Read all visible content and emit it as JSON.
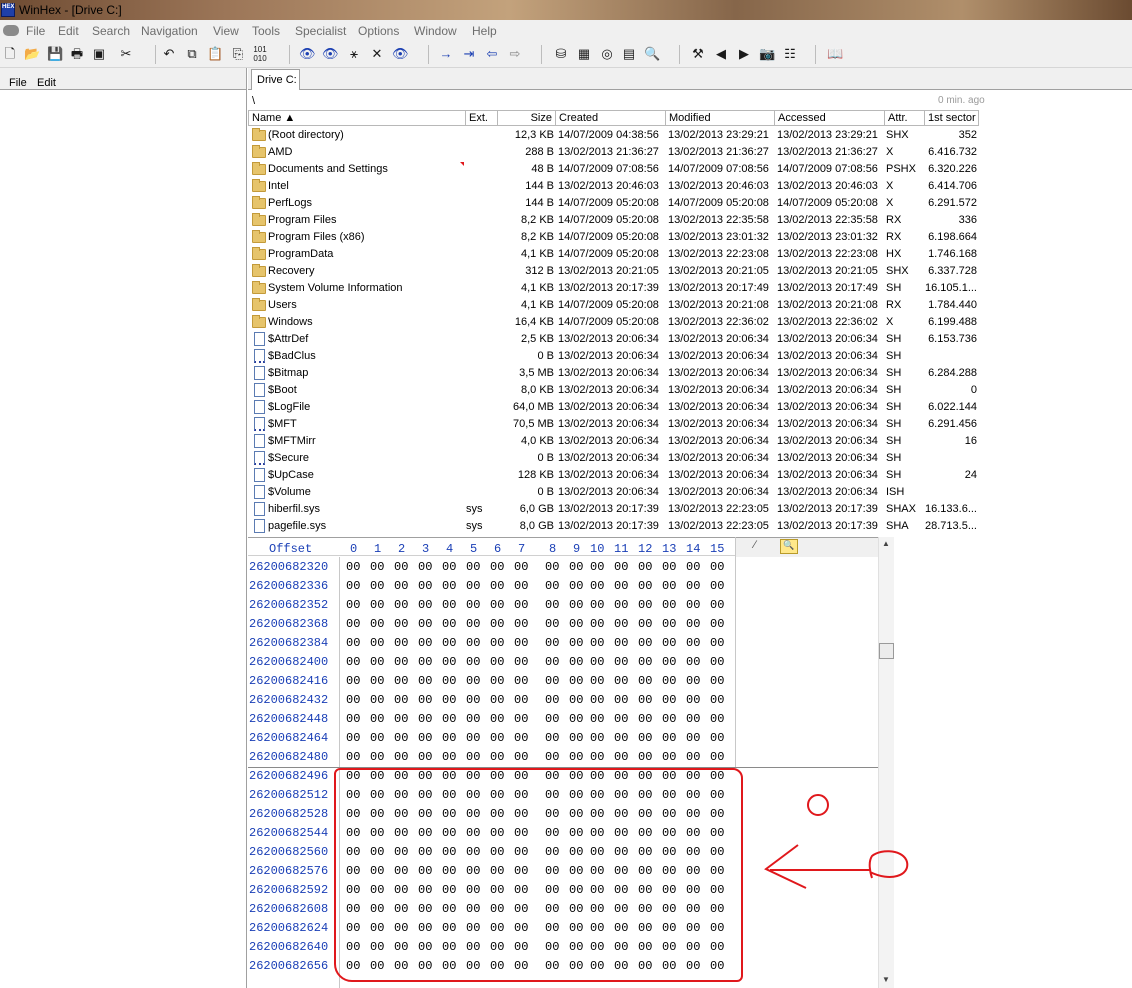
{
  "window": {
    "title": "WinHex - [Drive C:]",
    "app_icon_text": "HEX"
  },
  "menu": [
    "File",
    "Edit",
    "Search",
    "Navigation",
    "View",
    "Tools",
    "Specialist",
    "Options",
    "Window",
    "Help"
  ],
  "toolbar": {
    "icons": [
      "new-file-icon",
      "open-icon",
      "save-icon",
      "print-icon",
      "properties-icon",
      "cut-icon",
      "undo-icon",
      "copy-icon",
      "paste-icon",
      "paste-special-icon",
      "copy-hex-icon",
      "find-icon",
      "find-hex-icon",
      "replace-icon",
      "replace-hex-icon",
      "find-next-icon",
      "goto-offset-icon",
      "goto-sector-icon",
      "back-icon",
      "forward-icon",
      "disk-icon",
      "ram-icon",
      "drive-icon",
      "calculator-icon",
      "search-icon",
      "tools-icon",
      "prev-icon",
      "next-icon",
      "snapshot-icon",
      "list-icon",
      "help-icon"
    ]
  },
  "left_menu": {
    "file": "File",
    "edit": "Edit"
  },
  "tab": {
    "label": "Drive C:"
  },
  "path": {
    "current": "\\",
    "ago": "0 min. ago"
  },
  "columns": [
    {
      "key": "name",
      "label": "Name ▲"
    },
    {
      "key": "ext",
      "label": "Ext."
    },
    {
      "key": "size",
      "label": "Size"
    },
    {
      "key": "created",
      "label": "Created"
    },
    {
      "key": "modified",
      "label": "Modified"
    },
    {
      "key": "accessed",
      "label": "Accessed"
    },
    {
      "key": "attr",
      "label": "Attr."
    },
    {
      "key": "sector",
      "label": "1st sector"
    }
  ],
  "files": [
    {
      "name": "(Root directory)",
      "ext": "",
      "size": "12,3 KB",
      "created": "14/07/2009  04:38:56",
      "modified": "13/02/2013  23:29:21",
      "accessed": "13/02/2013  23:29:21",
      "attr": "SHX",
      "sector": "352",
      "icon": "folder"
    },
    {
      "name": "AMD",
      "ext": "",
      "size": "288 B",
      "created": "13/02/2013  21:36:27",
      "modified": "13/02/2013  21:36:27",
      "accessed": "13/02/2013  21:36:27",
      "attr": "X",
      "sector": "6.416.732",
      "icon": "folder"
    },
    {
      "name": "Documents and Settings",
      "ext": "",
      "size": "48 B",
      "created": "14/07/2009  07:08:56",
      "modified": "14/07/2009  07:08:56",
      "accessed": "14/07/2009  07:08:56",
      "attr": "PSHX",
      "sector": "6.320.226",
      "icon": "folder"
    },
    {
      "name": "Intel",
      "ext": "",
      "size": "144 B",
      "created": "13/02/2013  20:46:03",
      "modified": "13/02/2013  20:46:03",
      "accessed": "13/02/2013  20:46:03",
      "attr": "X",
      "sector": "6.414.706",
      "icon": "folder"
    },
    {
      "name": "PerfLogs",
      "ext": "",
      "size": "144 B",
      "created": "14/07/2009  05:20:08",
      "modified": "14/07/2009  05:20:08",
      "accessed": "14/07/2009  05:20:08",
      "attr": "X",
      "sector": "6.291.572",
      "icon": "folder"
    },
    {
      "name": "Program Files",
      "ext": "",
      "size": "8,2 KB",
      "created": "14/07/2009  05:20:08",
      "modified": "13/02/2013  22:35:58",
      "accessed": "13/02/2013  22:35:58",
      "attr": "RX",
      "sector": "336",
      "icon": "folder"
    },
    {
      "name": "Program Files (x86)",
      "ext": "",
      "size": "8,2 KB",
      "created": "14/07/2009  05:20:08",
      "modified": "13/02/2013  23:01:32",
      "accessed": "13/02/2013  23:01:32",
      "attr": "RX",
      "sector": "6.198.664",
      "icon": "folder"
    },
    {
      "name": "ProgramData",
      "ext": "",
      "size": "4,1 KB",
      "created": "14/07/2009  05:20:08",
      "modified": "13/02/2013  22:23:08",
      "accessed": "13/02/2013  22:23:08",
      "attr": "HX",
      "sector": "1.746.168",
      "icon": "folder"
    },
    {
      "name": "Recovery",
      "ext": "",
      "size": "312 B",
      "created": "13/02/2013  20:21:05",
      "modified": "13/02/2013  20:21:05",
      "accessed": "13/02/2013  20:21:05",
      "attr": "SHX",
      "sector": "6.337.728",
      "icon": "folder"
    },
    {
      "name": "System Volume Information",
      "ext": "",
      "size": "4,1 KB",
      "created": "13/02/2013  20:17:39",
      "modified": "13/02/2013  20:17:49",
      "accessed": "13/02/2013  20:17:49",
      "attr": "SH",
      "sector": "16.105.1...",
      "icon": "folder"
    },
    {
      "name": "Users",
      "ext": "",
      "size": "4,1 KB",
      "created": "14/07/2009  05:20:08",
      "modified": "13/02/2013  20:21:08",
      "accessed": "13/02/2013  20:21:08",
      "attr": "RX",
      "sector": "1.784.440",
      "icon": "folder"
    },
    {
      "name": "Windows",
      "ext": "",
      "size": "16,4 KB",
      "created": "14/07/2009  05:20:08",
      "modified": "13/02/2013  22:36:02",
      "accessed": "13/02/2013  22:36:02",
      "attr": "X",
      "sector": "6.199.488",
      "icon": "folder"
    },
    {
      "name": "$AttrDef",
      "ext": "",
      "size": "2,5 KB",
      "created": "13/02/2013  20:06:34",
      "modified": "13/02/2013  20:06:34",
      "accessed": "13/02/2013  20:06:34",
      "attr": "SH",
      "sector": "6.153.736",
      "icon": "file"
    },
    {
      "name": "$BadClus",
      "ext": "",
      "size": "0 B",
      "created": "13/02/2013  20:06:34",
      "modified": "13/02/2013  20:06:34",
      "accessed": "13/02/2013  20:06:34",
      "attr": "SH",
      "sector": "",
      "icon": "file-dots"
    },
    {
      "name": "$Bitmap",
      "ext": "",
      "size": "3,5 MB",
      "created": "13/02/2013  20:06:34",
      "modified": "13/02/2013  20:06:34",
      "accessed": "13/02/2013  20:06:34",
      "attr": "SH",
      "sector": "6.284.288",
      "icon": "file"
    },
    {
      "name": "$Boot",
      "ext": "",
      "size": "8,0 KB",
      "created": "13/02/2013  20:06:34",
      "modified": "13/02/2013  20:06:34",
      "accessed": "13/02/2013  20:06:34",
      "attr": "SH",
      "sector": "0",
      "icon": "file"
    },
    {
      "name": "$LogFile",
      "ext": "",
      "size": "64,0 MB",
      "created": "13/02/2013  20:06:34",
      "modified": "13/02/2013  20:06:34",
      "accessed": "13/02/2013  20:06:34",
      "attr": "SH",
      "sector": "6.022.144",
      "icon": "file"
    },
    {
      "name": "$MFT",
      "ext": "",
      "size": "70,5 MB",
      "created": "13/02/2013  20:06:34",
      "modified": "13/02/2013  20:06:34",
      "accessed": "13/02/2013  20:06:34",
      "attr": "SH",
      "sector": "6.291.456",
      "icon": "file-dots"
    },
    {
      "name": "$MFTMirr",
      "ext": "",
      "size": "4,0 KB",
      "created": "13/02/2013  20:06:34",
      "modified": "13/02/2013  20:06:34",
      "accessed": "13/02/2013  20:06:34",
      "attr": "SH",
      "sector": "16",
      "icon": "file"
    },
    {
      "name": "$Secure",
      "ext": "",
      "size": "0 B",
      "created": "13/02/2013  20:06:34",
      "modified": "13/02/2013  20:06:34",
      "accessed": "13/02/2013  20:06:34",
      "attr": "SH",
      "sector": "",
      "icon": "file-dots"
    },
    {
      "name": "$UpCase",
      "ext": "",
      "size": "128 KB",
      "created": "13/02/2013  20:06:34",
      "modified": "13/02/2013  20:06:34",
      "accessed": "13/02/2013  20:06:34",
      "attr": "SH",
      "sector": "24",
      "icon": "file"
    },
    {
      "name": "$Volume",
      "ext": "",
      "size": "0 B",
      "created": "13/02/2013  20:06:34",
      "modified": "13/02/2013  20:06:34",
      "accessed": "13/02/2013  20:06:34",
      "attr": "ISH",
      "sector": "",
      "icon": "file"
    },
    {
      "name": "hiberfil.sys",
      "ext": "sys",
      "size": "6,0 GB",
      "created": "13/02/2013  20:17:39",
      "modified": "13/02/2013  22:23:05",
      "accessed": "13/02/2013  20:17:39",
      "attr": "SHAX",
      "sector": "16.133.6...",
      "icon": "file"
    },
    {
      "name": "pagefile.sys",
      "ext": "sys",
      "size": "8,0 GB",
      "created": "13/02/2013  20:17:39",
      "modified": "13/02/2013  22:23:05",
      "accessed": "13/02/2013  20:17:39",
      "attr": "SHA",
      "sector": "28.713.5...",
      "icon": "file"
    }
  ],
  "hex": {
    "offset_label": "Offset",
    "columns": [
      "0",
      "1",
      "2",
      "3",
      "4",
      "5",
      "6",
      "7",
      "8",
      "9",
      "10",
      "11",
      "12",
      "13",
      "14",
      "15"
    ],
    "offsets": [
      "26200682320",
      "26200682336",
      "26200682352",
      "26200682368",
      "26200682384",
      "26200682400",
      "26200682416",
      "26200682432",
      "26200682448",
      "26200682464",
      "26200682480",
      "26200682496",
      "26200682512",
      "26200682528",
      "26200682544",
      "26200682560",
      "26200682576",
      "26200682592",
      "26200682608",
      "26200682624",
      "26200682640",
      "26200682656"
    ],
    "byte_value": "00"
  },
  "annotation": {
    "color": "#e0181c"
  }
}
